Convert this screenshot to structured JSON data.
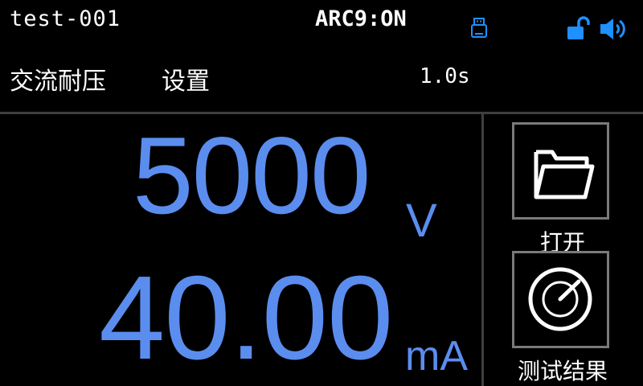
{
  "header": {
    "file_name": "test-001",
    "arc_status": "ARC9:ON",
    "icons": [
      "usb-icon",
      "unlock-icon",
      "speaker-icon"
    ]
  },
  "test": {
    "mode": "交流耐压",
    "settings_label": "设置",
    "time": "1.0s"
  },
  "readings": {
    "voltage": "5000",
    "voltage_unit": "V",
    "current": "40.00",
    "current_unit": "mA"
  },
  "buttons": {
    "open_label": "打开",
    "result_label": "测试结果"
  },
  "colors": {
    "accent": "#5B8DEF",
    "icon_blue": "#1E90FF",
    "divider": "#3F3F3F",
    "button_border": "#7A7A7A"
  }
}
